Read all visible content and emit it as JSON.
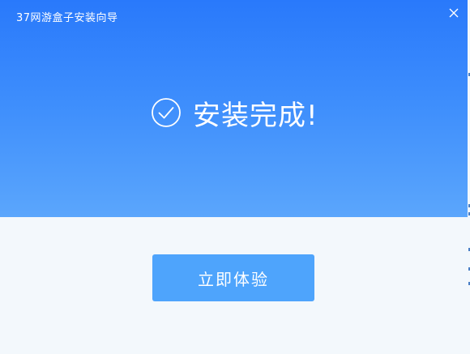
{
  "window": {
    "title": "37网游盒子安装向导"
  },
  "header": {
    "status_text": "安装完成!",
    "status_icon": "check-circle-icon"
  },
  "actions": {
    "primary_label": "立即体验"
  },
  "colors": {
    "header_top": "#2979fb",
    "header_bottom": "#5ba6fc",
    "body_bg": "#f3f8fc",
    "button_bg": "#4ea4fc",
    "text_on_accent": "#ffffff"
  }
}
